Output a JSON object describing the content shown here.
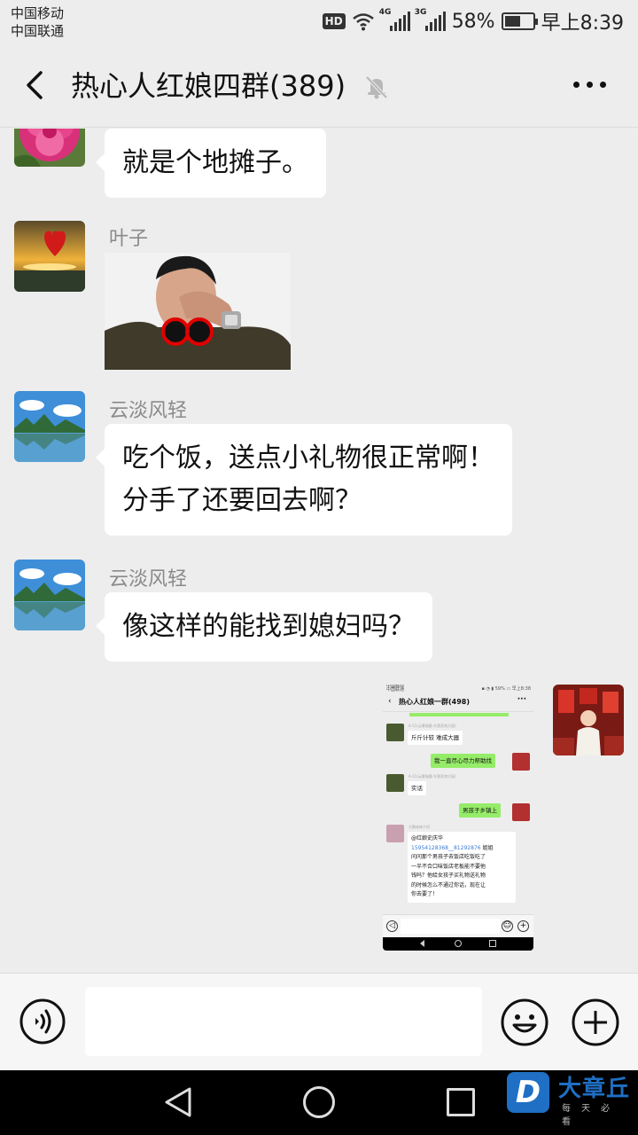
{
  "status_bar": {
    "carrier_1": "中国移动",
    "carrier_2": "中国联通",
    "hd": "HD",
    "net_1": "4G",
    "net_2": "3G",
    "battery": "58%",
    "battery_level": 0.58,
    "time": "早上8:39"
  },
  "header": {
    "title": "热心人红娘四群(389)",
    "back_icon": "chevron-left-icon",
    "mute_icon": "bell-off-icon",
    "more_icon": "more-dots-icon"
  },
  "messages": [
    {
      "sender": "",
      "avatar": "pink-flower-avatar",
      "text": "就是个地摊子。"
    },
    {
      "sender": "叶子",
      "avatar": "sunset-heart-avatar",
      "sticker": "facepalm-sticker"
    },
    {
      "sender": "云淡风轻",
      "avatar": "landscape-avatar",
      "line1": "吃个饭，送点小礼物很正常啊！",
      "line2": "分手了还要回去啊？"
    },
    {
      "sender": "云淡风轻",
      "avatar": "landscape-avatar",
      "text": "像这样的能找到媳妇吗？"
    }
  ],
  "shared_screenshot": {
    "carrier_1": "中国移动",
    "carrier_2": "中国联通",
    "status_right": "▪ ◔ ▮ 59% ▭ 早上8:38",
    "title": "热心人红娘一群(498)",
    "back": "‹",
    "mute": "🔕",
    "more": "···",
    "rows": [
      {
        "name": "A-11(云雾福晨-东营家南大厨)",
        "text": "斤斤计较 难成大器"
      },
      {
        "self": true,
        "text": "我一直尽心尽力帮助找"
      },
      {
        "name": "A-11(云雾福晨-东营家南大厨)",
        "text": "实话"
      },
      {
        "self": true,
        "text": "男孩子乡镇上"
      },
      {
        "name": "大鹏妹妹介绍"
      }
    ],
    "long_msg": {
      "mention": "@红娘史庆华",
      "phones": "15954128368__81292876",
      "after_phones": " 姐姐",
      "lines": [
        "问问那个男孩子去饭店吃饭吃了",
        "一半不合口味饭店老板能不要他",
        "钱吗？他给女孩子买礼物送礼物",
        "的时候怎么不通过你话，现在让",
        "你去要了！"
      ]
    },
    "voice": "◁",
    "emoji": "☺",
    "plus": "+"
  },
  "input_bar": {
    "voice_icon": "voice-icon",
    "emoji_icon": "emoji-icon",
    "plus_icon": "plus-icon",
    "message_value": ""
  },
  "watermark": {
    "logo": "D",
    "name": "大章丘",
    "slogan": "每天必看"
  },
  "colors": {
    "background": "#ededed",
    "bubble_in": "#ffffff",
    "bubble_out": "#95ec69",
    "name_text": "#8a8a8a"
  }
}
